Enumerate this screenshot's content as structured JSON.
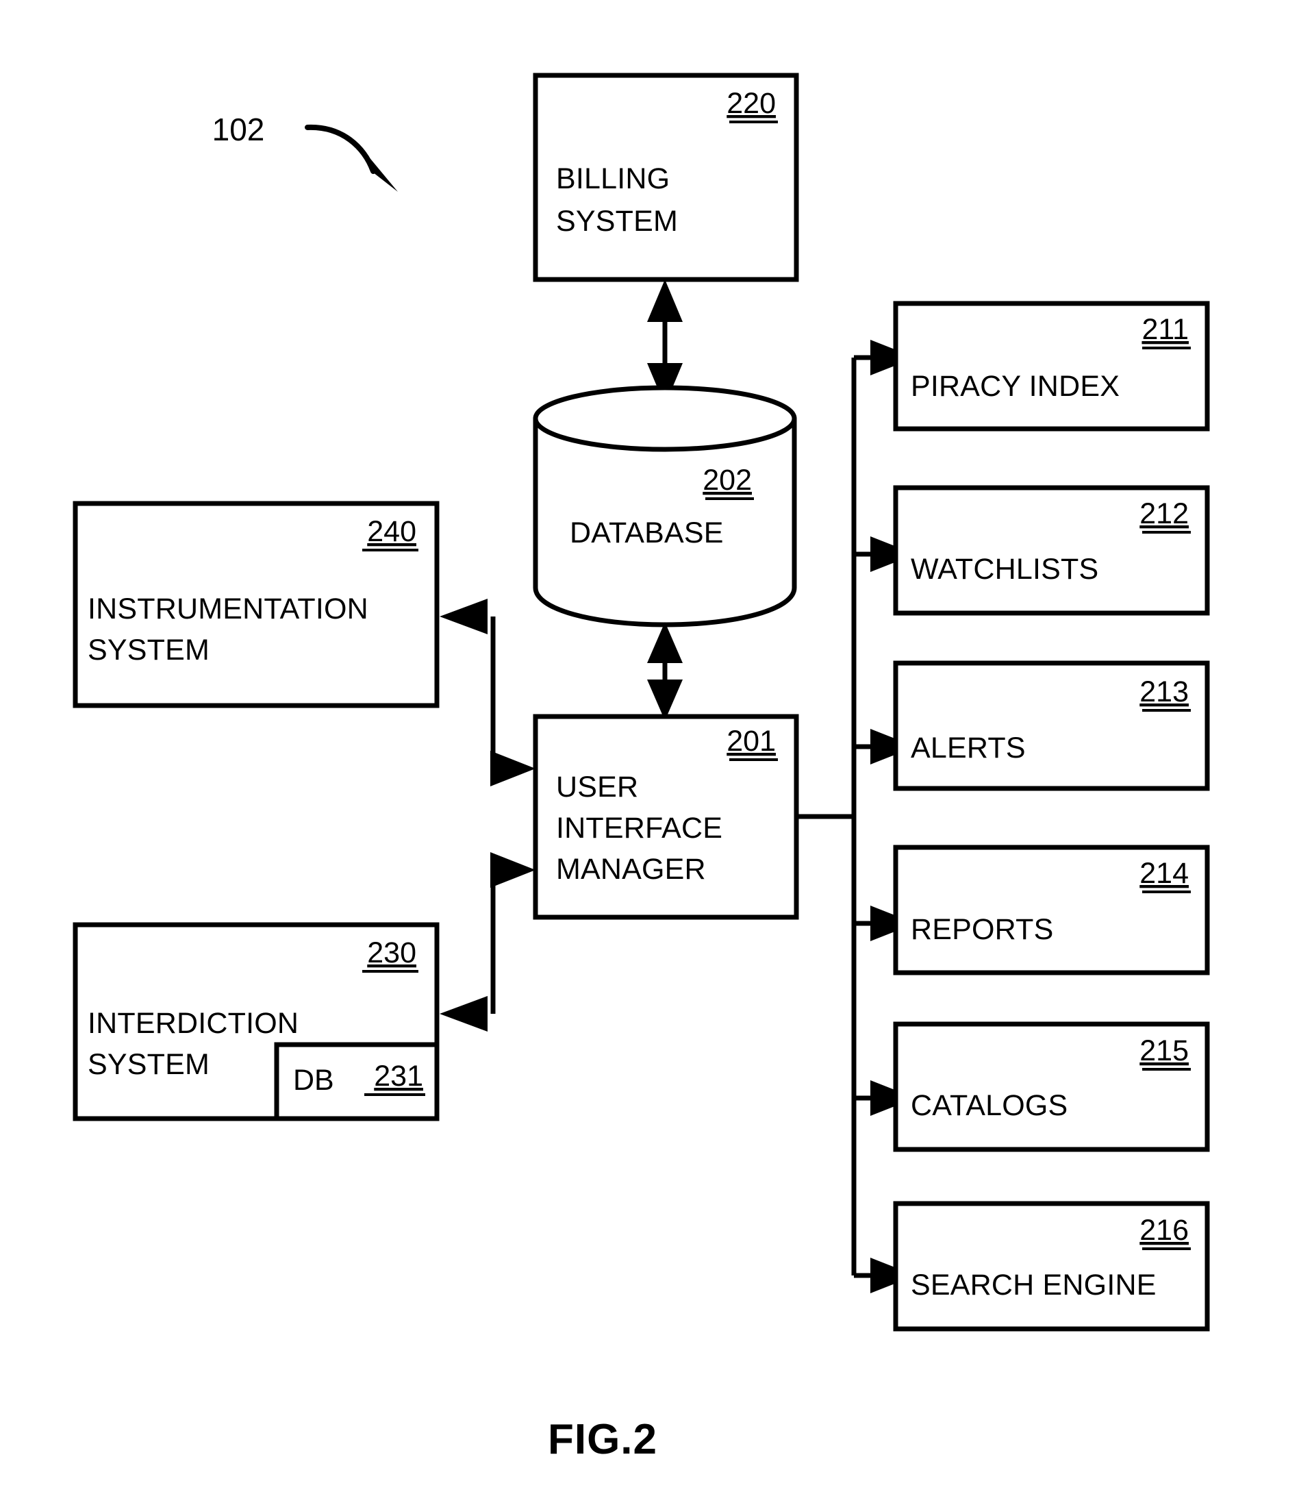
{
  "figure": {
    "caption": "FIG.2",
    "callout_reference": "102"
  },
  "nodes": {
    "billing_system": {
      "label_lines": [
        "BILLING",
        "SYSTEM"
      ],
      "ref": "220"
    },
    "database": {
      "label": "DATABASE",
      "ref": "202"
    },
    "user_interface_manager": {
      "label_lines": [
        "USER",
        "INTERFACE",
        "MANAGER"
      ],
      "ref": "201"
    },
    "instrumentation_system": {
      "label_lines": [
        "INSTRUMENTATION",
        "SYSTEM"
      ],
      "ref": "240"
    },
    "interdiction_system": {
      "label_lines": [
        "INTERDICTION",
        "SYSTEM"
      ],
      "ref": "230"
    },
    "interdiction_db": {
      "label": "DB",
      "ref": "231"
    },
    "piracy_index": {
      "label": "PIRACY INDEX",
      "ref": "211"
    },
    "watchlists": {
      "label": "WATCHLISTS",
      "ref": "212"
    },
    "alerts": {
      "label": "ALERTS",
      "ref": "213"
    },
    "reports": {
      "label": "REPORTS",
      "ref": "214"
    },
    "catalogs": {
      "label": "CATALOGS",
      "ref": "215"
    },
    "search_engine": {
      "label": "SEARCH ENGINE",
      "ref": "216"
    }
  },
  "colors": {
    "line": "#000000",
    "fill": "#ffffff",
    "text": "#000000"
  }
}
